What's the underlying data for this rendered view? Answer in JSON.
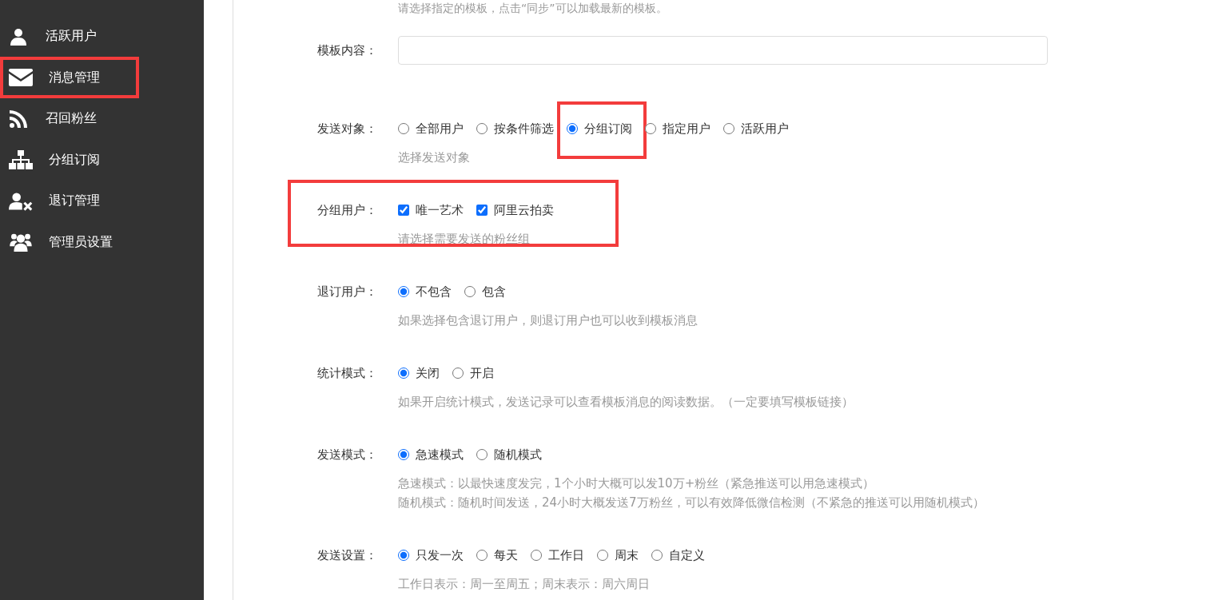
{
  "sidebar": {
    "items": [
      {
        "label": "活跃用户",
        "highlighted": false
      },
      {
        "label": "消息管理",
        "highlighted": true
      },
      {
        "label": "召回粉丝",
        "highlighted": false
      },
      {
        "label": "分组订阅",
        "highlighted": false
      },
      {
        "label": "退订管理",
        "highlighted": false
      },
      {
        "label": "管理员设置",
        "highlighted": false
      }
    ]
  },
  "form": {
    "top_hint": "请选择指定的模板，点击“同步”可以加载最新的模板。",
    "fields": [
      {
        "kind": "text",
        "label": "模板内容：",
        "highlighted": false
      },
      {
        "kind": "radio",
        "label": "发送对象：",
        "highlighted": false,
        "options": [
          {
            "label": "全部用户",
            "selected": false,
            "highlighted": false
          },
          {
            "label": "按条件筛选",
            "selected": false,
            "highlighted": false
          },
          {
            "label": "分组订阅",
            "selected": true,
            "highlighted": true
          },
          {
            "label": "指定用户",
            "selected": false,
            "highlighted": false
          },
          {
            "label": "活跃用户",
            "selected": false,
            "highlighted": false
          }
        ],
        "hints": [
          "选择发送对象"
        ]
      },
      {
        "kind": "checkbox",
        "label": "分组用户：",
        "highlighted": true,
        "options": [
          {
            "label": "唯一艺术",
            "checked": true
          },
          {
            "label": "阿里云拍卖",
            "checked": true
          }
        ],
        "hints": [
          "请选择需要发送的粉丝组"
        ]
      },
      {
        "kind": "radio",
        "label": "退订用户：",
        "highlighted": false,
        "options": [
          {
            "label": "不包含",
            "selected": true,
            "highlighted": false
          },
          {
            "label": "包含",
            "selected": false,
            "highlighted": false
          }
        ],
        "hints": [
          "如果选择包含退订用户，则退订用户也可以收到模板消息"
        ]
      },
      {
        "kind": "radio",
        "label": "统计模式：",
        "highlighted": false,
        "options": [
          {
            "label": "关闭",
            "selected": true,
            "highlighted": false
          },
          {
            "label": "开启",
            "selected": false,
            "highlighted": false
          }
        ],
        "hints": [
          "如果开启统计模式，发送记录可以查看模板消息的阅读数据。（一定要填写模板链接）"
        ]
      },
      {
        "kind": "radio",
        "label": "发送模式：",
        "highlighted": false,
        "options": [
          {
            "label": "急速模式",
            "selected": true,
            "highlighted": false
          },
          {
            "label": "随机模式",
            "selected": false,
            "highlighted": false
          }
        ],
        "hints": [
          "急速模式：以最快速度发完，1个小时大概可以发10万+粉丝（紧急推送可以用急速模式）",
          "随机模式：随机时间发送，24小时大概发送7万粉丝，可以有效降低微信检测（不紧急的推送可以用随机模式）"
        ]
      },
      {
        "kind": "radio",
        "label": "发送设置：",
        "highlighted": false,
        "options": [
          {
            "label": "只发一次",
            "selected": true,
            "highlighted": false
          },
          {
            "label": "每天",
            "selected": false,
            "highlighted": false
          },
          {
            "label": "工作日",
            "selected": false,
            "highlighted": false
          },
          {
            "label": "周末",
            "selected": false,
            "highlighted": false
          },
          {
            "label": "自定义",
            "selected": false,
            "highlighted": false
          }
        ],
        "hints": [
          "工作日表示：周一至周五；周末表示：周六周日"
        ]
      }
    ]
  }
}
